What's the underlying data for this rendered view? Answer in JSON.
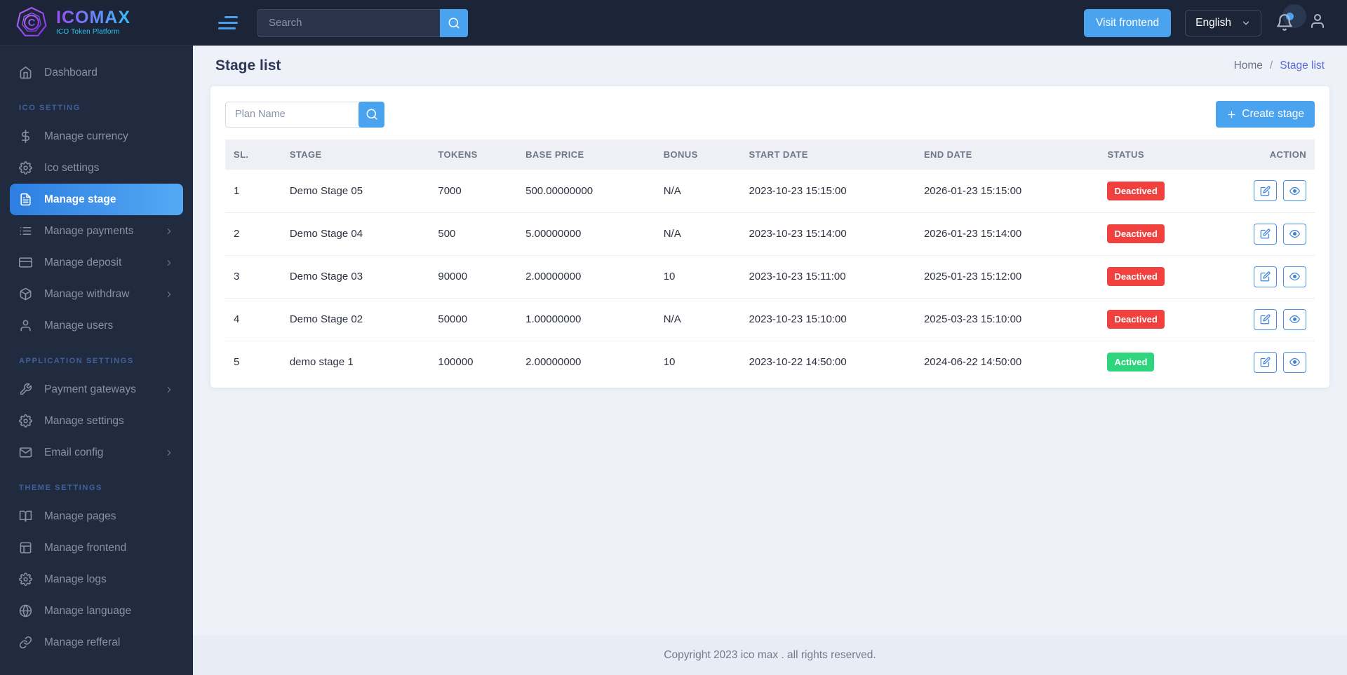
{
  "brand": {
    "name": "ICOMAX",
    "tagline": "ICO Token Platform"
  },
  "topbar": {
    "search_placeholder": "Search",
    "visit_frontend": "Visit frontend",
    "language": "English"
  },
  "sidebar": {
    "sections": [
      {
        "header": "",
        "items": [
          {
            "label": "Dashboard",
            "icon": "home",
            "chevron": false,
            "active": false
          }
        ]
      },
      {
        "header": "ICO SETTING",
        "items": [
          {
            "label": "Manage currency",
            "icon": "dollar",
            "chevron": false,
            "active": false
          },
          {
            "label": "Ico settings",
            "icon": "gear",
            "chevron": false,
            "active": false
          },
          {
            "label": "Manage stage",
            "icon": "file-text",
            "chevron": false,
            "active": true
          },
          {
            "label": "Manage payments",
            "icon": "list",
            "chevron": true,
            "active": false
          },
          {
            "label": "Manage deposit",
            "icon": "credit-card",
            "chevron": true,
            "active": false
          },
          {
            "label": "Manage withdraw",
            "icon": "package",
            "chevron": true,
            "active": false
          },
          {
            "label": "Manage users",
            "icon": "user",
            "chevron": false,
            "active": false
          }
        ]
      },
      {
        "header": "APPLICATION SETTINGS",
        "items": [
          {
            "label": "Payment gateways",
            "icon": "wrench",
            "chevron": true,
            "active": false
          },
          {
            "label": "Manage settings",
            "icon": "gear",
            "chevron": false,
            "active": false
          },
          {
            "label": "Email config",
            "icon": "mail",
            "chevron": true,
            "active": false
          }
        ]
      },
      {
        "header": "THEME SETTINGS",
        "items": [
          {
            "label": "Manage pages",
            "icon": "book-open",
            "chevron": false,
            "active": false
          },
          {
            "label": "Manage frontend",
            "icon": "layout",
            "chevron": false,
            "active": false
          },
          {
            "label": "Manage logs",
            "icon": "gear",
            "chevron": false,
            "active": false
          },
          {
            "label": "Manage language",
            "icon": "globe",
            "chevron": false,
            "active": false
          },
          {
            "label": "Manage refferal",
            "icon": "link",
            "chevron": false,
            "active": false
          }
        ]
      }
    ]
  },
  "page": {
    "title": "Stage list",
    "breadcrumb": {
      "home": "Home",
      "separator": "/",
      "current": "Stage list"
    }
  },
  "filters": {
    "plan_name_placeholder": "Plan Name",
    "create_stage_label": "Create stage"
  },
  "table": {
    "headers": [
      "SL.",
      "STAGE",
      "TOKENS",
      "BASE PRICE",
      "BONUS",
      "START DATE",
      "END DATE",
      "STATUS",
      "ACTION"
    ],
    "rows": [
      {
        "sl": "1",
        "stage": "Demo Stage 05",
        "tokens": "7000",
        "base_price": "500.00000000",
        "bonus": "N/A",
        "start": "2023-10-23 15:15:00",
        "end": "2026-01-23 15:15:00",
        "status": "Deactived",
        "status_type": "danger"
      },
      {
        "sl": "2",
        "stage": "Demo Stage 04",
        "tokens": "500",
        "base_price": "5.00000000",
        "bonus": "N/A",
        "start": "2023-10-23 15:14:00",
        "end": "2026-01-23 15:14:00",
        "status": "Deactived",
        "status_type": "danger"
      },
      {
        "sl": "3",
        "stage": "Demo Stage 03",
        "tokens": "90000",
        "base_price": "2.00000000",
        "bonus": "10",
        "start": "2023-10-23 15:11:00",
        "end": "2025-01-23 15:12:00",
        "status": "Deactived",
        "status_type": "danger"
      },
      {
        "sl": "4",
        "stage": "Demo Stage 02",
        "tokens": "50000",
        "base_price": "1.00000000",
        "bonus": "N/A",
        "start": "2023-10-23 15:10:00",
        "end": "2025-03-23 15:10:00",
        "status": "Deactived",
        "status_type": "danger"
      },
      {
        "sl": "5",
        "stage": "demo stage 1",
        "tokens": "100000",
        "base_price": "2.00000000",
        "bonus": "10",
        "start": "2023-10-22 14:50:00",
        "end": "2024-06-22 14:50:00",
        "status": "Actived",
        "status_type": "success"
      }
    ]
  },
  "footer": {
    "copyright": "Copyright 2023 ico max . all rights reserved."
  },
  "colors": {
    "accent_blue": "#4aa3ef",
    "sidebar_bg": "#212b40",
    "topbar_bg": "#1b2537",
    "danger": "#f0413e",
    "success": "#2ed57c",
    "breadcrumb_active": "#5a6cdb"
  }
}
